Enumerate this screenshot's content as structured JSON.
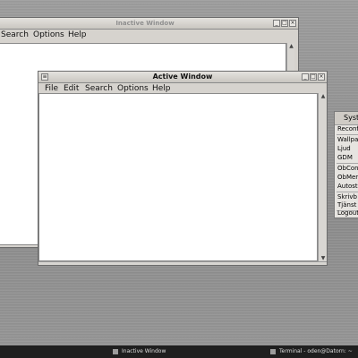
{
  "inactive_window": {
    "title": "Inactive Window",
    "menu": [
      "Search",
      "Options",
      "Help"
    ]
  },
  "active_window": {
    "title": "Active Window",
    "menu": [
      "File",
      "Edit",
      "Search",
      "Options",
      "Help"
    ]
  },
  "root_menu": {
    "title": "Syst",
    "items": [
      "Reconf",
      "Wallpap",
      "Ljud",
      "GDM",
      "ObCon",
      "ObMen",
      "Autost",
      "Skrivb",
      "Tjänst",
      "Logout"
    ]
  },
  "taskbar": {
    "inactive_task": "Inactive Window",
    "terminal_task": "Terminal - oden@Datorn: ~"
  },
  "icons": [
    "window-menu-icon",
    "minimize-icon",
    "maximize-icon",
    "close-icon",
    "scroll-up-arrow-icon",
    "scroll-down-arrow-icon"
  ]
}
